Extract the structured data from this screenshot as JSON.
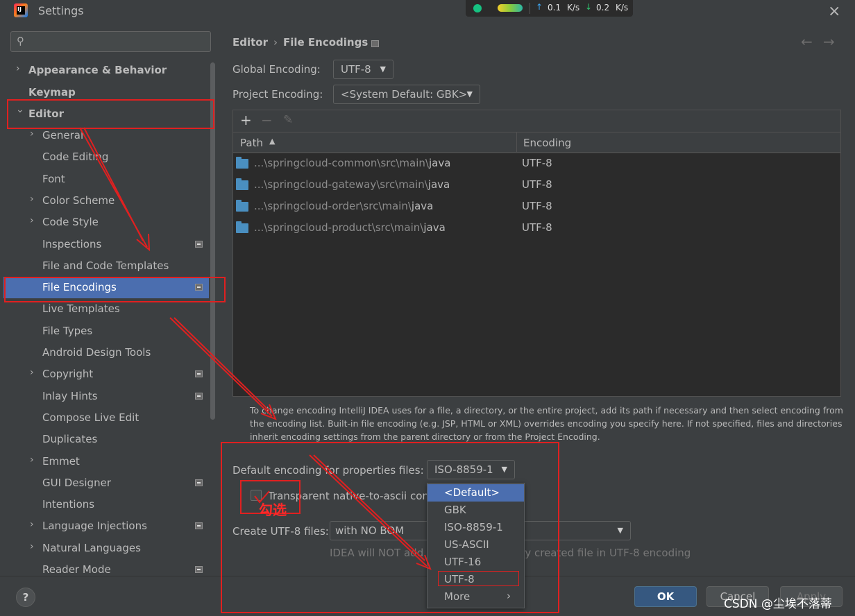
{
  "window": {
    "title": "Settings",
    "close_icon": "×"
  },
  "network_widget": {
    "upload_speed": "0.1",
    "upload_unit": "K/s",
    "download_speed": "0.2",
    "download_unit": "K/s",
    "status_color": "#16c281"
  },
  "sidebar": {
    "search": {
      "placeholder": "",
      "value": ""
    },
    "items": [
      {
        "label": "Appearance & Behavior",
        "bold": true,
        "expander": "collapsed"
      },
      {
        "label": "Keymap",
        "bold": true
      },
      {
        "label": "Editor",
        "bold": true,
        "expander": "expanded"
      },
      {
        "label": "General",
        "expander": "collapsed"
      },
      {
        "label": "Code Editing"
      },
      {
        "label": "Font"
      },
      {
        "label": "Color Scheme",
        "expander": "collapsed"
      },
      {
        "label": "Code Style",
        "expander": "collapsed"
      },
      {
        "label": "Inspections",
        "project_icon": true
      },
      {
        "label": "File and Code Templates"
      },
      {
        "label": "File Encodings",
        "project_icon": true,
        "selected": true
      },
      {
        "label": "Live Templates"
      },
      {
        "label": "File Types"
      },
      {
        "label": "Android Design Tools"
      },
      {
        "label": "Copyright",
        "expander": "collapsed",
        "project_icon": true
      },
      {
        "label": "Inlay Hints",
        "project_icon": true
      },
      {
        "label": "Compose Live Edit"
      },
      {
        "label": "Duplicates"
      },
      {
        "label": "Emmet",
        "expander": "collapsed"
      },
      {
        "label": "GUI Designer",
        "project_icon": true
      },
      {
        "label": "Intentions"
      },
      {
        "label": "Language Injections",
        "expander": "collapsed",
        "project_icon": true
      },
      {
        "label": "Natural Languages",
        "expander": "collapsed"
      },
      {
        "label": "Reader Mode",
        "project_icon": true
      }
    ]
  },
  "main": {
    "breadcrumb": {
      "parent": "Editor",
      "separator": "›",
      "current": "File Encodings"
    },
    "global_encoding": {
      "label": "Global Encoding:",
      "value": "UTF-8"
    },
    "project_encoding": {
      "label": "Project Encoding:",
      "value": "<System Default: GBK>"
    },
    "table": {
      "toolbar": {
        "add": "+",
        "remove": "−",
        "edit": "✎"
      },
      "columns": [
        "Path",
        "Encoding"
      ],
      "rows": [
        {
          "path_prefix": "...\\springcloud-common\\src\\main\\",
          "path_tail": "java",
          "encoding": "UTF-8"
        },
        {
          "path_prefix": "...\\springcloud-gateway\\src\\main\\",
          "path_tail": "java",
          "encoding": "UTF-8"
        },
        {
          "path_prefix": "...\\springcloud-order\\src\\main\\",
          "path_tail": "java",
          "encoding": "UTF-8"
        },
        {
          "path_prefix": "...\\springcloud-product\\src\\main\\",
          "path_tail": "java",
          "encoding": "UTF-8"
        }
      ]
    },
    "help_text": "To change encoding IntelliJ IDEA uses for a file, a directory, or the entire project, add its path if necessary and then select encoding from the encoding list. Built-in file encoding (e.g. JSP, HTML or XML) overrides encoding you specify here. If not specified, files and directories inherit encoding settings from the parent directory or from the Project Encoding.",
    "properties_encoding": {
      "label": "Default encoding for properties files:",
      "value": "ISO-8859-1"
    },
    "transparent_ascii": {
      "label": "Transparent native-to-ascii conv",
      "checked": false
    },
    "utf8_files": {
      "label": "Create UTF-8 files:",
      "value": "with NO BOM"
    },
    "hint": "IDEA will NOT add UTF-8 BOM to every created file in UTF-8 encoding"
  },
  "dropdown": {
    "options": [
      "<Default>",
      "GBK",
      "ISO-8859-1",
      "US-ASCII",
      "UTF-16",
      "UTF-8",
      "More"
    ],
    "highlighted": "<Default>",
    "more_chevron": "›"
  },
  "annotation": {
    "check_note": "勾选",
    "color": "#e02020"
  },
  "buttons": {
    "help": "?",
    "ok": "OK",
    "cancel": "Cancel",
    "apply": "Apply"
  },
  "watermark": "CSDN @尘埃不落蒂"
}
